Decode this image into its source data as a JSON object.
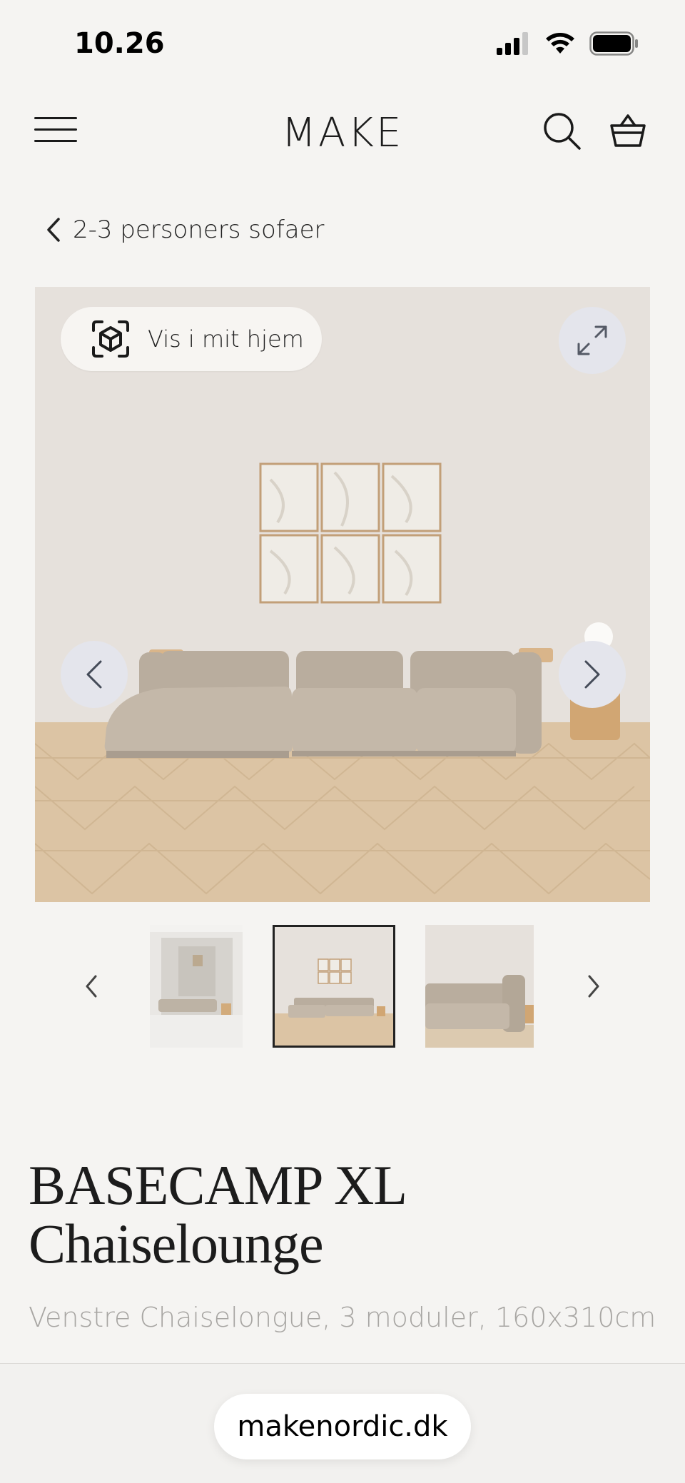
{
  "status": {
    "time": "10.26"
  },
  "header": {
    "logo": "MAKE"
  },
  "breadcrumb": {
    "label": "2-3 personers sofaer"
  },
  "gallery": {
    "ar_label": "Vis i mit hjem"
  },
  "product": {
    "title_line1": "BASECAMP XL",
    "title_line2": "Chaiselounge",
    "subtitle": "Venstre Chaiselongue, 3 moduler, 160x310cm"
  },
  "browser": {
    "url": "makenordic.dk"
  },
  "colors": {
    "background": "#f5f4f2",
    "wall": "#e6e1dc",
    "floor": "#dcc4a4",
    "sofa": "#b9ad9e",
    "nav_button": "#e4e5ec"
  }
}
